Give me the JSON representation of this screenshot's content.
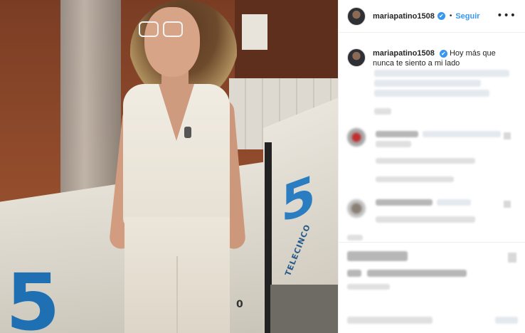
{
  "post": {
    "username": "mariapatino1508",
    "verified_mark": "✔",
    "separator": "•",
    "follow_label": "Seguir",
    "more_label": "•••",
    "caption_line1": "Hoy más que",
    "caption_line2": "nunca te siento a mi lado"
  },
  "photo": {
    "logo_digit": "5",
    "logo_text": "TELECINCO",
    "ground_mark": "0"
  },
  "colors": {
    "accent": "#3897f0",
    "text": "#262626",
    "border": "#efefef"
  }
}
